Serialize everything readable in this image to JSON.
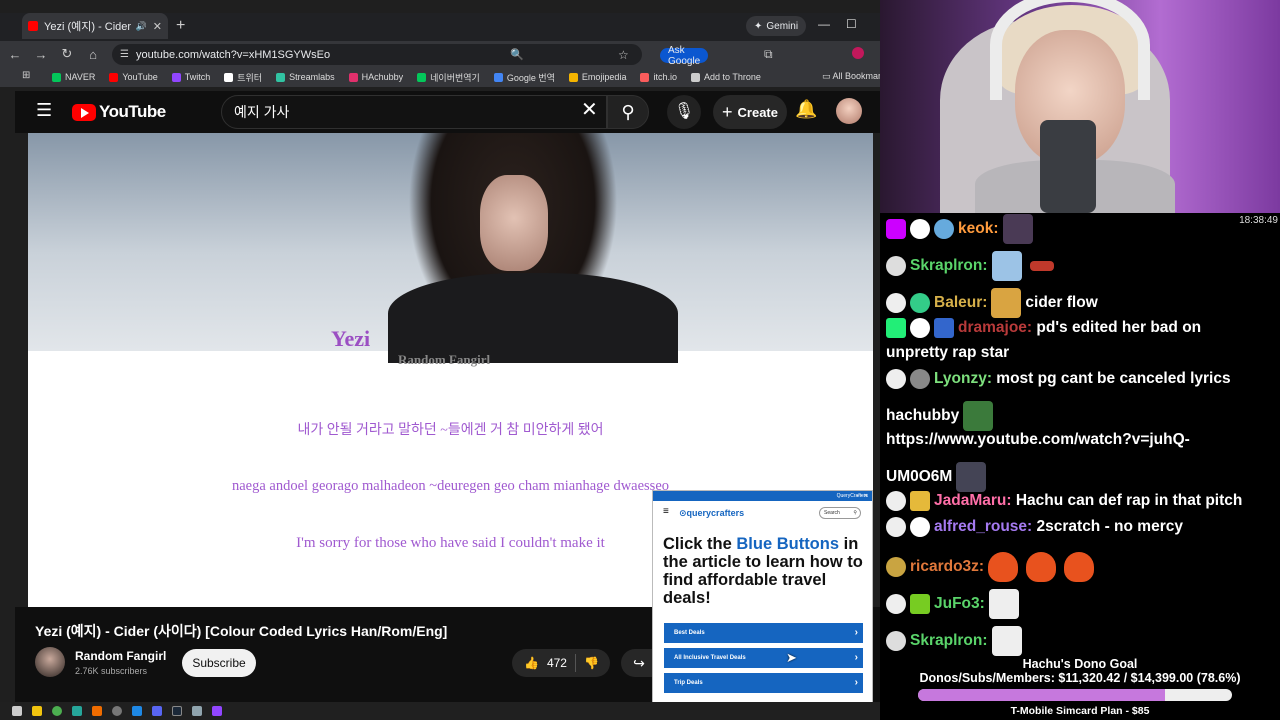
{
  "browser": {
    "tab_title": "Yezi (예지) - Cider (사이다)",
    "url": "youtube.com/watch?v=xHM1SGYWsEo",
    "ask_google": "Ask Google",
    "gemini": "Gemini",
    "bookmarks": [
      {
        "label": "NAVER",
        "color": "#03c75a"
      },
      {
        "label": "YouTube",
        "color": "#ff0000"
      },
      {
        "label": "Twitch",
        "color": "#9146ff"
      },
      {
        "label": "트위터",
        "color": "#ffffff"
      },
      {
        "label": "Streamlabs",
        "color": "#31c3a2"
      },
      {
        "label": "HAchubby",
        "color": "#e1306c"
      },
      {
        "label": "네이버번역기",
        "color": "#03c75a"
      },
      {
        "label": "Google 번역",
        "color": "#4285f4"
      },
      {
        "label": "Emojipedia",
        "color": "#f4b400"
      },
      {
        "label": "itch.io",
        "color": "#fa5c5c"
      },
      {
        "label": "Add to Throne",
        "color": "#cccccc"
      }
    ],
    "all_bookmarks": "All Bookmark"
  },
  "youtube": {
    "logo": "YouTube",
    "search_value": "예지 가사",
    "create": "Create",
    "video": {
      "artist_watermark": "Yezi",
      "channel_watermark": "Random Fangirl",
      "lyric_han": "내가 안될 거라고 말하던 ~들에겐 거 참 미안하게 됐어",
      "lyric_rom": "naega andoel georago malhadeon ~deuregen geo cham mianhage dwaesseo",
      "lyric_eng": "I'm sorry for those who have said I couldn't make it"
    },
    "title": "Yezi (예지) - Cider (사이다) [Colour Coded Lyrics Han/Rom/Eng]",
    "channel": "Random Fangirl",
    "subscribers": "2.76K subscribers",
    "subscribe": "Subscribe",
    "likes": "472"
  },
  "ad": {
    "header": "QueryCrafters",
    "brand": "querycrafters",
    "search": "Search",
    "headline_pre": "Click the ",
    "headline_blue": "Blue Buttons",
    "headline_post": " in the article to learn how to find affordable travel deals!",
    "buttons": [
      "Best Deals",
      "All Inclusive Travel Deals",
      "Trip Deals"
    ]
  },
  "stream": {
    "clock": "18:38:49",
    "chat": [
      {
        "user": "keok:",
        "color": "#ff9b3d",
        "text": ""
      },
      {
        "user": "Skraplron:",
        "color": "#5ad46a",
        "text": ""
      },
      {
        "user": "Baleur:",
        "color": "#d6b04a",
        "text": "cider flow"
      },
      {
        "user": "dramajoe:",
        "color": "#b83a3a",
        "text": "pd's edited her bad on"
      },
      {
        "user": "",
        "color": "#ffffff",
        "text": "unpretty rap star"
      },
      {
        "user": "Lyonzy:",
        "color": "#7de07d",
        "text": "most pg cant be canceled lyrics"
      },
      {
        "user": "",
        "color": "#ffffff",
        "text": "hachubby"
      },
      {
        "user": "",
        "color": "#ffffff",
        "text": "https://www.youtube.com/watch?v=juhQ-"
      },
      {
        "user": "",
        "color": "#ffffff",
        "text": "UM0O6M"
      },
      {
        "user": "JadaMaru:",
        "color": "#ff6fa8",
        "text": "Hachu can def rap in that pitch"
      },
      {
        "user": "alfred_rouse:",
        "color": "#a57af0",
        "text": "2scratch - no mercy"
      },
      {
        "user": "ricardo3z:",
        "color": "#e0783b",
        "text": ""
      },
      {
        "user": "JuFo3:",
        "color": "#5ad46a",
        "text": ""
      },
      {
        "user": "Skraplron:",
        "color": "#5ad46a",
        "text": ""
      }
    ],
    "goal_title": "Hachu's Dono Goal",
    "goal_text": "Donos/Subs/Members: $11,320.42 / $14,399.00 (78.6%)",
    "goal_fraction": 0.786,
    "goal_footer": "T-Mobile Simcard Plan - $85"
  }
}
